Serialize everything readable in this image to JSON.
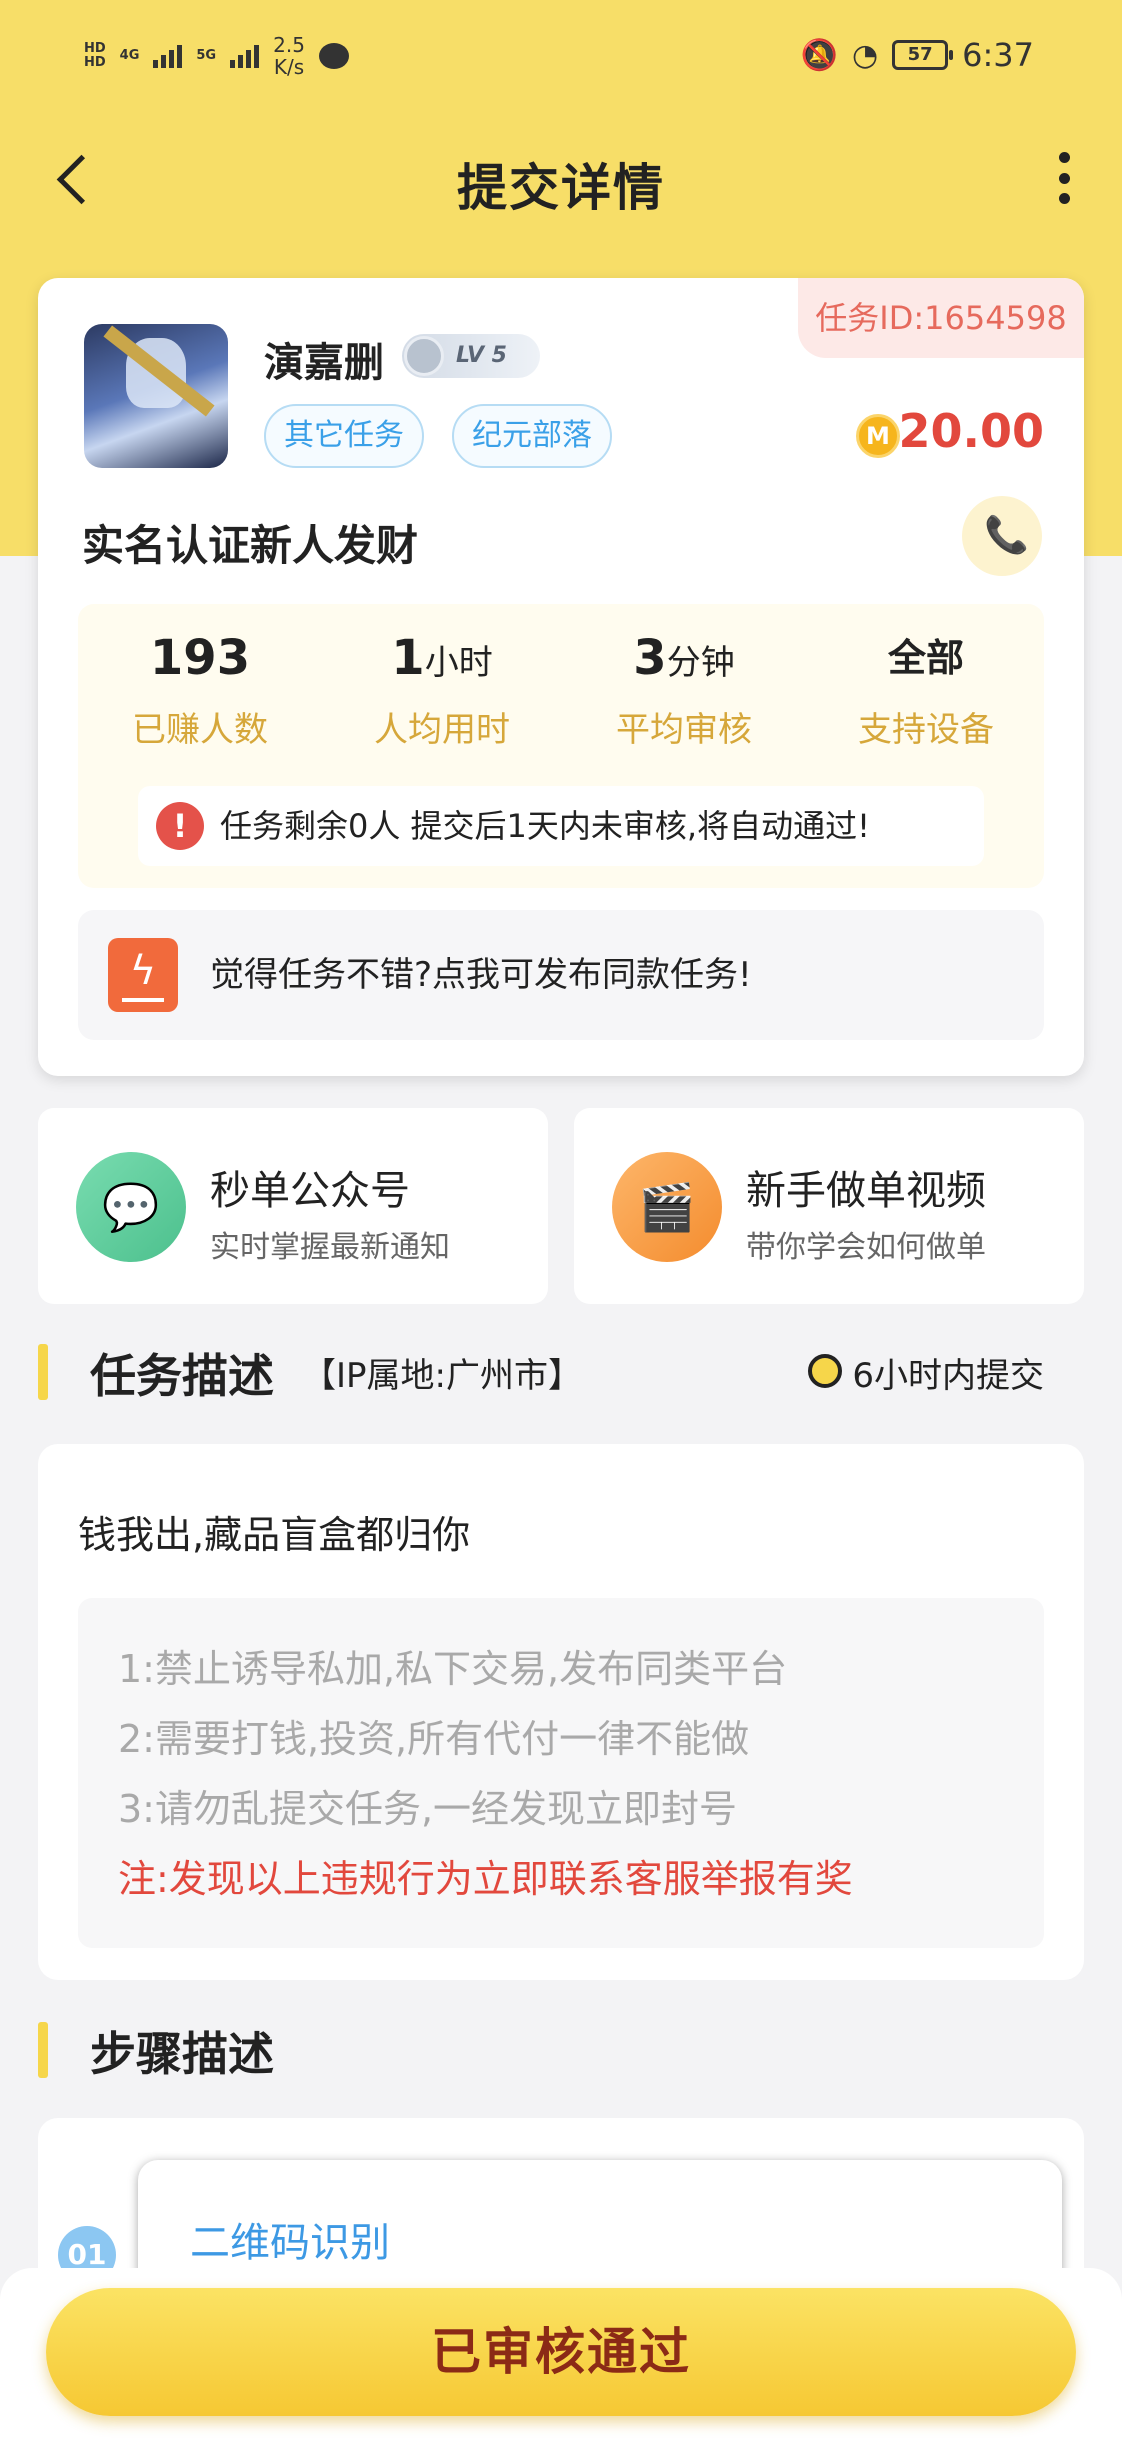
{
  "status_bar": {
    "hd_top": "HD",
    "hd_bottom": "HD",
    "net1": "4G",
    "net2": "5G",
    "speed_value": "2.5",
    "speed_unit": "K/s",
    "battery": "57",
    "time": "6:37"
  },
  "header": {
    "title": "提交详情"
  },
  "task": {
    "id_label": "任务ID:1654598",
    "user_name": "演嘉删",
    "level": "LV 5",
    "tags": [
      "其它任务",
      "纪元部落"
    ],
    "coin_symbol": "M",
    "reward": "20.00",
    "title": "实名认证新人发财",
    "stats": [
      {
        "value": "193",
        "unit": "",
        "label": "已赚人数"
      },
      {
        "value": "1",
        "unit": "小时",
        "label": "人均用时"
      },
      {
        "value": "3",
        "unit": "分钟",
        "label": "平均审核"
      },
      {
        "value": "全部",
        "unit": "",
        "label": "支持设备"
      }
    ],
    "warning": "任务剩余0人  提交后1天内未审核,将自动通过!",
    "publish_prompt": "觉得任务不错?点我可发布同款任务!"
  },
  "promos": [
    {
      "title": "秒单公众号",
      "subtitle": "实时掌握最新通知",
      "icon": "wechat-icon"
    },
    {
      "title": "新手做单视频",
      "subtitle": "带你学会如何做单",
      "icon": "video-icon"
    }
  ],
  "description": {
    "heading": "任务描述",
    "ip_location": "【IP属地:广州市】",
    "deadline": "6小时内提交",
    "text": "钱我出,藏品盲盒都归你",
    "rules": [
      "1:禁止诱导私加,私下交易,发布同类平台",
      "2:需要打钱,投资,所有代付一律不能做",
      "3:请勿乱提交任务,一经发现立即封号"
    ],
    "notice": "注:发现以上违规行为立即联系客服举报有奖"
  },
  "steps": {
    "heading": "步骤描述",
    "items": [
      {
        "number": "01",
        "label": "二维码识别"
      }
    ]
  },
  "action": {
    "label": "已审核通过"
  },
  "colors": {
    "header_bg": "#f7de68",
    "reward": "#e2483d",
    "tag": "#3aa0e8",
    "stat_label": "#d6a73a",
    "button": "#f6c833"
  }
}
